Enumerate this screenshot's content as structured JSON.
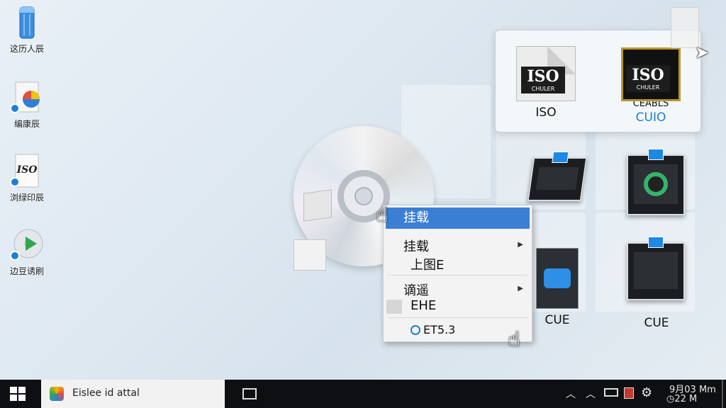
{
  "desktop_icons": [
    {
      "label": "这历人辰",
      "icon": "recycle-bin-icon"
    },
    {
      "label": "编康辰",
      "icon": "app-ball-icon"
    },
    {
      "label": "浏绿印辰",
      "icon": "iso-file-icon",
      "glyph_text": "ISO"
    },
    {
      "label": "边豆诱刷",
      "icon": "media-player-icon"
    }
  ],
  "popup_files": [
    {
      "label": "ISO",
      "band": "ISO",
      "band_sub": "CHULER"
    },
    {
      "label": "CUIO",
      "band": "ISO",
      "band_sub": "CHULER",
      "extra": "CEABLS",
      "color": "#1e7fd4"
    }
  ],
  "file_tiles": [
    {
      "label": "CUE",
      "icon": "cue-file-icon"
    },
    {
      "label": "CUE",
      "icon": "device-image-icon"
    }
  ],
  "context_menu": {
    "highlighted": "挂载",
    "items": [
      {
        "label": "挂载",
        "has_submenu": true
      },
      {
        "label": "上图E",
        "has_submenu": false
      },
      {
        "label": "谪遥",
        "has_submenu": true
      },
      {
        "label": "EHE",
        "has_submenu": false
      },
      {
        "label": "ET5.3",
        "has_submenu": false
      }
    ]
  },
  "taskbar": {
    "search_text": "Eislee id attal",
    "clock_line1": "9月03 Mm",
    "clock_line2": "22 M"
  }
}
